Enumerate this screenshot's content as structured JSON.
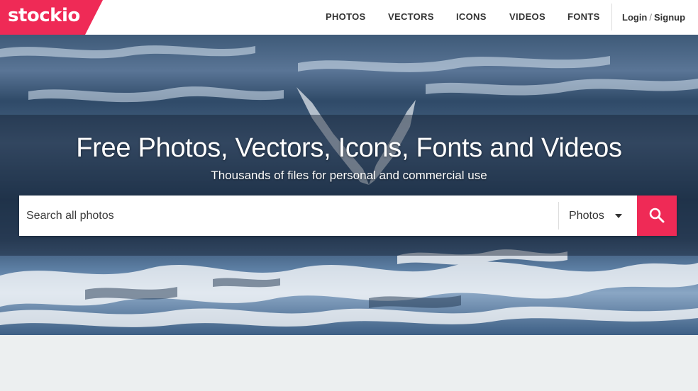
{
  "brand": {
    "logo_text": "stockio",
    "accent_color": "#ef2a56"
  },
  "nav": {
    "items": [
      {
        "label": "PHOTOS"
      },
      {
        "label": "VECTORS"
      },
      {
        "label": "ICONS"
      },
      {
        "label": "VIDEOS"
      },
      {
        "label": "FONTS"
      }
    ],
    "login": "Login",
    "separator": "/",
    "signup": "Signup"
  },
  "hero": {
    "title": "Free Photos, Vectors, Icons, Fonts and Videos",
    "subtitle": "Thousands of files for personal and commercial use"
  },
  "search": {
    "placeholder": "Search all photos",
    "type_selected": "Photos",
    "button_icon": "search-icon"
  }
}
